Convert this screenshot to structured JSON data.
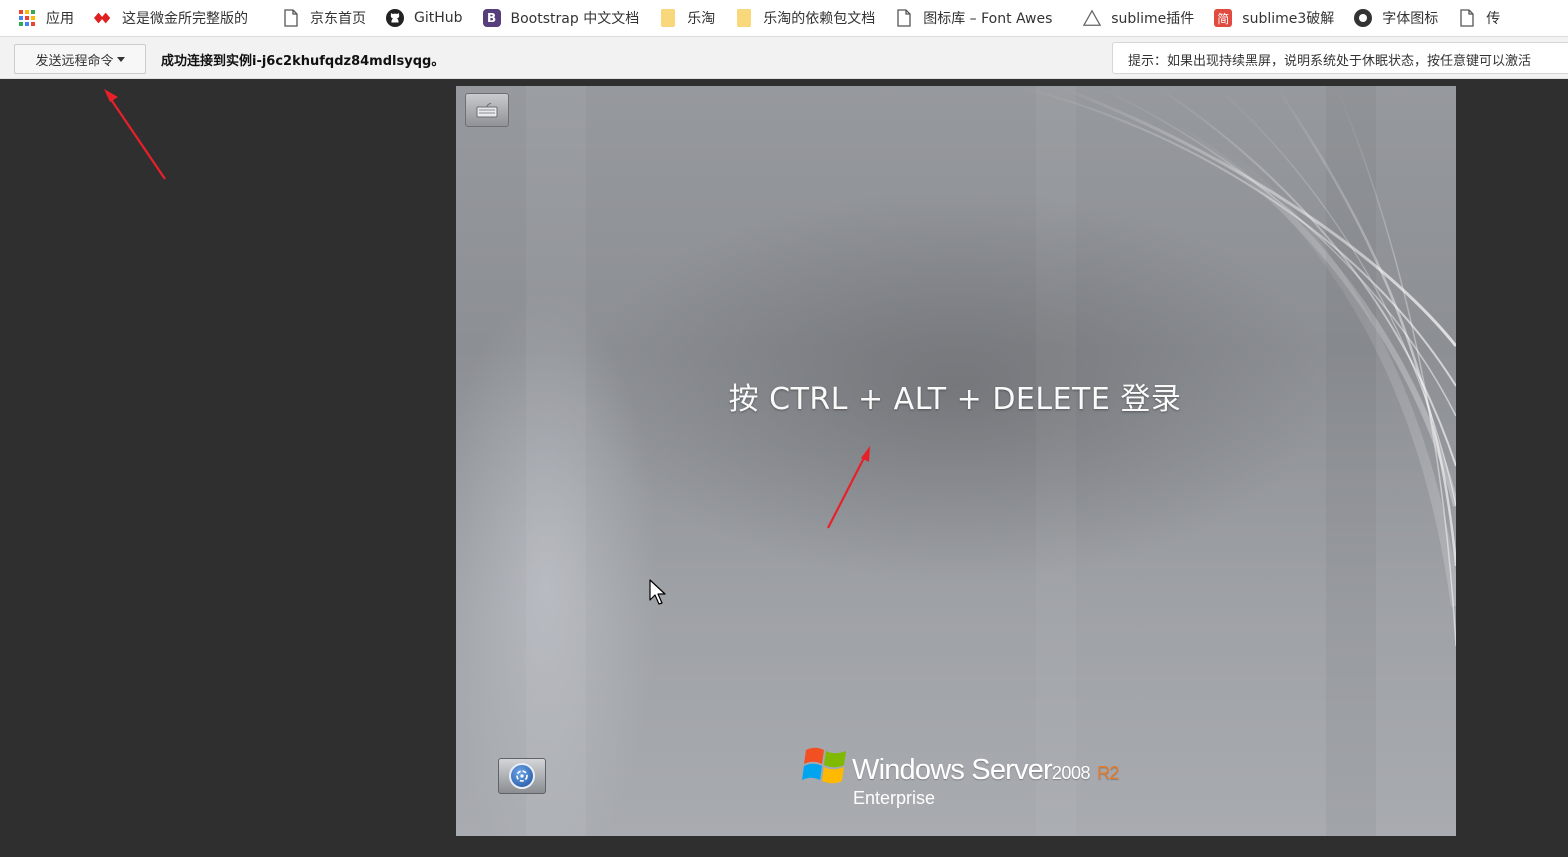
{
  "bookmarks": [
    {
      "icon": "apps-grid-icon",
      "label": "应用"
    },
    {
      "icon": "weijin-icon",
      "label": "这是微金所完整版的"
    },
    {
      "icon": "page-icon",
      "label": "京东首页"
    },
    {
      "icon": "github-icon",
      "label": "GitHub"
    },
    {
      "icon": "bootstrap-icon",
      "label": "Bootstrap 中文文档"
    },
    {
      "icon": "folder-icon",
      "label": "乐淘"
    },
    {
      "icon": "folder-icon",
      "label": "乐淘的依赖包文档"
    },
    {
      "icon": "page-icon",
      "label": "图标库 – Font Awes"
    },
    {
      "icon": "sublime-icon",
      "label": "sublime插件"
    },
    {
      "icon": "jian-icon",
      "label": "sublime3破解"
    },
    {
      "icon": "font-icon",
      "label": "字体图标"
    },
    {
      "icon": "page-icon",
      "label": "传"
    }
  ],
  "bookmark_glyphs": {
    "bootstrap": "B",
    "jian": "简"
  },
  "toolbar": {
    "send_command_label": "发送远程命令",
    "connection_message": "成功连接到实例i-j6c2khufqdz84mdlsyqg。",
    "tip": "提示：如果出现持续黑屏，说明系统处于休眠状态，按任意键可以激活"
  },
  "remote_screen": {
    "login_prompt": "按 CTRL + ALT + DELETE 登录",
    "brand_name": "Windows Server",
    "brand_year": "2008",
    "brand_release": "R2",
    "brand_edition": "Enterprise"
  },
  "colors": {
    "annotation_arrow": "#e8202a",
    "r2_accent": "#e87a28",
    "stage_background": "#2f2f2f"
  }
}
